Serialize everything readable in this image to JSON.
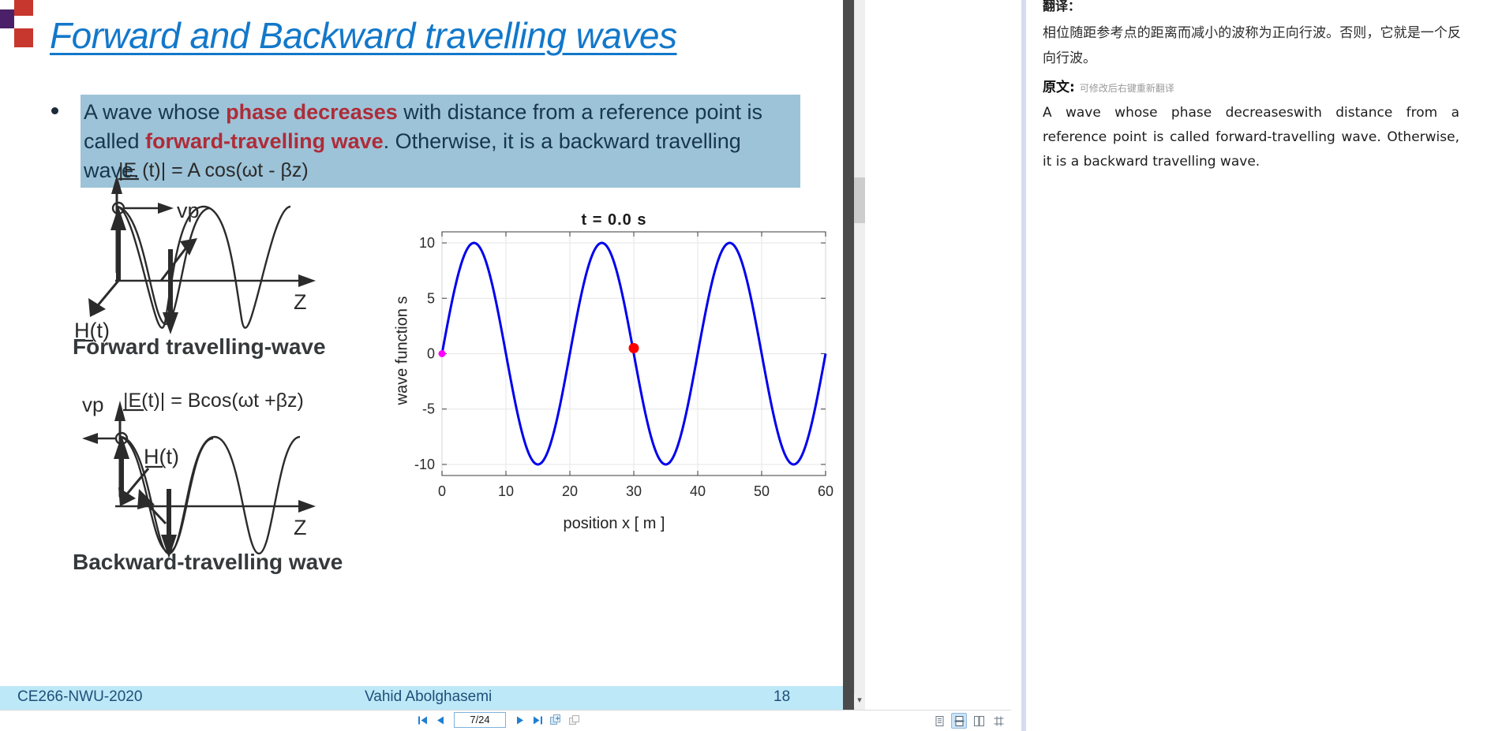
{
  "slide": {
    "title": "Forward and Backward travelling waves",
    "bullet": {
      "lead": "A wave whose ",
      "bold1": "phase decreases",
      "mid": " with distance from a reference point is called ",
      "bold2": "forward-travelling wave",
      "tail": ". Otherwise, it is a backward travelling wave."
    },
    "figures": {
      "forward": {
        "equation": "|E (t)| = A cos(ωt - βz)",
        "vp_label": "vp",
        "h_label": "H(t)",
        "axis_label": "Z",
        "caption": "Forward travelling-wave"
      },
      "backward": {
        "equation": "|E(t)| = Bcos(ωt +βz)",
        "vp_label": "vp",
        "h_label": "H(t)",
        "axis_label": "Z",
        "caption": "Backward-travelling wave"
      }
    },
    "footer": {
      "left": "CE266-NWU-2020",
      "center": "Vahid Abolghasemi",
      "right": "18"
    }
  },
  "chart_data": {
    "type": "line",
    "title": "t =  0.0   s",
    "xlabel": "position  x  [ m ]",
    "ylabel": "wave function  s",
    "xlim": [
      0,
      60
    ],
    "ylim": [
      -11,
      11
    ],
    "xticks": [
      0,
      10,
      20,
      30,
      40,
      50,
      60
    ],
    "yticks": [
      -10,
      -5,
      0,
      5,
      10
    ],
    "grid": true,
    "legend": "none",
    "series": [
      {
        "name": "wave",
        "color": "#0000EE",
        "amplitude": 10,
        "wavelength": 20,
        "phase_deg": 0,
        "form": "A*sin(2*pi*x/20)",
        "x_start": 0,
        "x_end": 60,
        "samples": 601
      }
    ],
    "markers": [
      {
        "name": "reference-point",
        "x": 0,
        "y": 0,
        "color": "#FF00FF",
        "size": 9
      },
      {
        "name": "tracked-point",
        "x": 30,
        "y": 0.5,
        "color": "#FF0000",
        "size": 13
      }
    ]
  },
  "toolbar": {
    "first_page": "first-page",
    "prev_page": "previous-page",
    "page_value": "7/24",
    "next_page": "next-page",
    "last_page": "last-page",
    "add_bookmark": "add-bookmark",
    "copy_page": "copy-page",
    "view_modes": [
      {
        "name": "single-page-view",
        "active": false
      },
      {
        "name": "continuous-scroll-view",
        "active": true
      },
      {
        "name": "two-page-view",
        "active": false
      },
      {
        "name": "fit-width-view",
        "active": false
      }
    ]
  },
  "translation_panel": {
    "translation_heading": "翻译：",
    "translation_text": "相位随距参考点的距离而减小的波称为正向行波。否则，它就是一个反向行波。",
    "source_heading": "原文:",
    "source_hint": "可修改后右键重新翻译",
    "source_text": "A wave whose phase decreaseswith distance from a reference point is called forward-travelling wave. Otherwise, it is a backward travelling wave."
  },
  "colors": {
    "title_blue": "#1278CA",
    "highlight_bg": "#9DC3D8",
    "bold_red": "#AE2C38",
    "footer_band": "#BDE8F7",
    "curve_blue": "#0000EE",
    "marker_red": "#FF0000",
    "marker_magenta": "#FF00FF"
  }
}
